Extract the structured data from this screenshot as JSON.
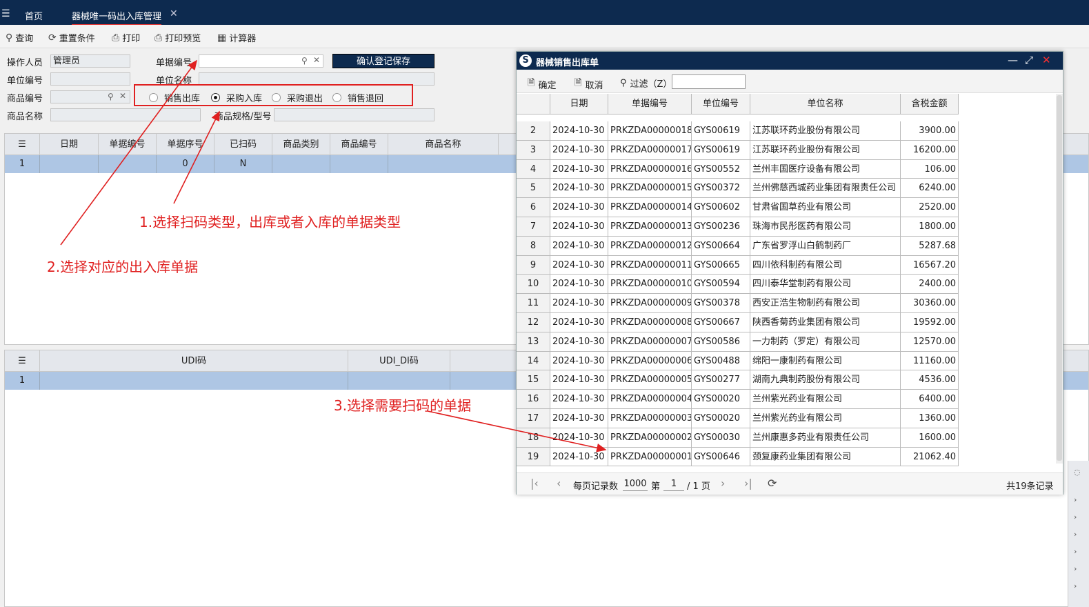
{
  "topbar": {
    "home_tab": "首页",
    "active_tab": "器械唯一码出入库管理",
    "close": "✕",
    "menu": "☰"
  },
  "toolbar": {
    "query": "查询",
    "reset": "重置条件",
    "print": "打印",
    "print_preview": "打印预览",
    "calculator": "计算器"
  },
  "form": {
    "operator_label": "操作人员",
    "operator_value": "管理员",
    "doc_no_label": "单据编号",
    "doc_no_value": "",
    "unit_code_label": "单位编号",
    "unit_name_label": "单位名称",
    "product_code_label": "商品编号",
    "product_name_label": "商品名称",
    "spec_label": "商品规格/型号",
    "save_button": "确认登记保存",
    "radios": [
      "销售出库",
      "采购入库",
      "采购退出",
      "销售退回"
    ],
    "radio_selected": "采购入库"
  },
  "main_grid": {
    "columns": [
      "日期",
      "单据编号",
      "单据序号",
      "已扫码",
      "商品类别",
      "商品编号",
      "商品名称"
    ],
    "row": {
      "index": "1",
      "seq": "0",
      "scanned": "N"
    }
  },
  "udi_grid": {
    "columns": [
      "UDI码",
      "UDI_DI码"
    ],
    "row_index": "1"
  },
  "annotations": {
    "a1": "1.选择扫码类型，出库或者入库的单据类型",
    "a2": "2.选择对应的出入库单据",
    "a3": "3.选择需要扫码的单据"
  },
  "dialog": {
    "title": "器械销售出库单",
    "confirm": "确定",
    "cancel": "取消",
    "filter": "过滤（Z）",
    "filter_value": "",
    "columns": [
      "日期",
      "单据编号",
      "单位编号",
      "单位名称",
      "含税金额"
    ],
    "rows": [
      [
        "2",
        "2024-10-30",
        "PRKZDA00000018",
        "GYS00619",
        "江苏联环药业股份有限公司",
        "3900.00"
      ],
      [
        "3",
        "2024-10-30",
        "PRKZDA00000017",
        "GYS00619",
        "江苏联环药业股份有限公司",
        "16200.00"
      ],
      [
        "4",
        "2024-10-30",
        "PRKZDA00000016",
        "GYS00552",
        "兰州丰国医疗设备有限公司",
        "106.00"
      ],
      [
        "5",
        "2024-10-30",
        "PRKZDA00000015",
        "GYS00372",
        "兰州佛慈西城药业集团有限责任公司",
        "6240.00"
      ],
      [
        "6",
        "2024-10-30",
        "PRKZDA00000014",
        "GYS00602",
        "甘肃省国草药业有限公司",
        "2520.00"
      ],
      [
        "7",
        "2024-10-30",
        "PRKZDA00000013",
        "GYS00236",
        "珠海市民彤医药有限公司",
        "1800.00"
      ],
      [
        "8",
        "2024-10-30",
        "PRKZDA00000012",
        "GYS00664",
        "广东省罗浮山白鹤制药厂",
        "5287.68"
      ],
      [
        "9",
        "2024-10-30",
        "PRKZDA00000011",
        "GYS00665",
        "四川依科制药有限公司",
        "16567.20"
      ],
      [
        "10",
        "2024-10-30",
        "PRKZDA00000010",
        "GYS00594",
        "四川泰华堂制药有限公司",
        "2400.00"
      ],
      [
        "11",
        "2024-10-30",
        "PRKZDA00000009",
        "GYS00378",
        "西安正浩生物制药有限公司",
        "30360.00"
      ],
      [
        "12",
        "2024-10-30",
        "PRKZDA00000008",
        "GYS00667",
        "陕西香菊药业集团有限公司",
        "19592.00"
      ],
      [
        "13",
        "2024-10-30",
        "PRKZDA00000007",
        "GYS00586",
        "一力制药（罗定）有限公司",
        "12570.00"
      ],
      [
        "14",
        "2024-10-30",
        "PRKZDA00000006",
        "GYS00488",
        "绵阳一康制药有限公司",
        "11160.00"
      ],
      [
        "15",
        "2024-10-30",
        "PRKZDA00000005",
        "GYS00277",
        "湖南九典制药股份有限公司",
        "4536.00"
      ],
      [
        "16",
        "2024-10-30",
        "PRKZDA00000004",
        "GYS00020",
        "兰州紫光药业有限公司",
        "6400.00"
      ],
      [
        "17",
        "2024-10-30",
        "PRKZDA00000003",
        "GYS00020",
        "兰州紫光药业有限公司",
        "1360.00"
      ],
      [
        "18",
        "2024-10-30",
        "PRKZDA00000002",
        "GYS00030",
        "兰州康惠多药业有限责任公司",
        "1600.00"
      ],
      [
        "19",
        "2024-10-30",
        "PRKZDA00000001",
        "GYS00646",
        "颈复康药业集团有限公司",
        "21062.40"
      ]
    ],
    "pager": {
      "per_page_label": "每页记录数",
      "per_page": "1000",
      "page_label": "第",
      "page": "1",
      "total_pages": "/ 1 页",
      "total": "共19条记录"
    }
  },
  "colors": {
    "navy": "#0d2a4f",
    "red": "#e02020",
    "selected_row": "#aec6e4"
  }
}
